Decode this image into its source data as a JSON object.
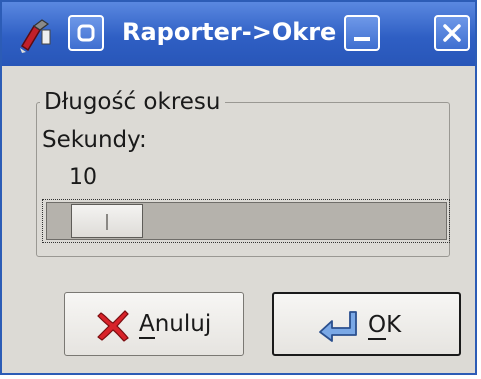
{
  "window": {
    "title": "Raporter->Okres",
    "accent": "#2f5fc4",
    "menu_button_icon": "window-menu-icon",
    "minimize_icon": "minimize-icon",
    "close_icon": "close-icon"
  },
  "frame": {
    "legend": "Długość okresu",
    "label": "Sekundy:",
    "value": "10"
  },
  "slider": {
    "level": 0.07
  },
  "buttons": {
    "cancel_first": "A",
    "cancel_rest": "nuluj",
    "cancel_icon": "red-x-icon",
    "ok_first": "O",
    "ok_rest": "K",
    "ok_icon": "enter-arrow-icon"
  }
}
